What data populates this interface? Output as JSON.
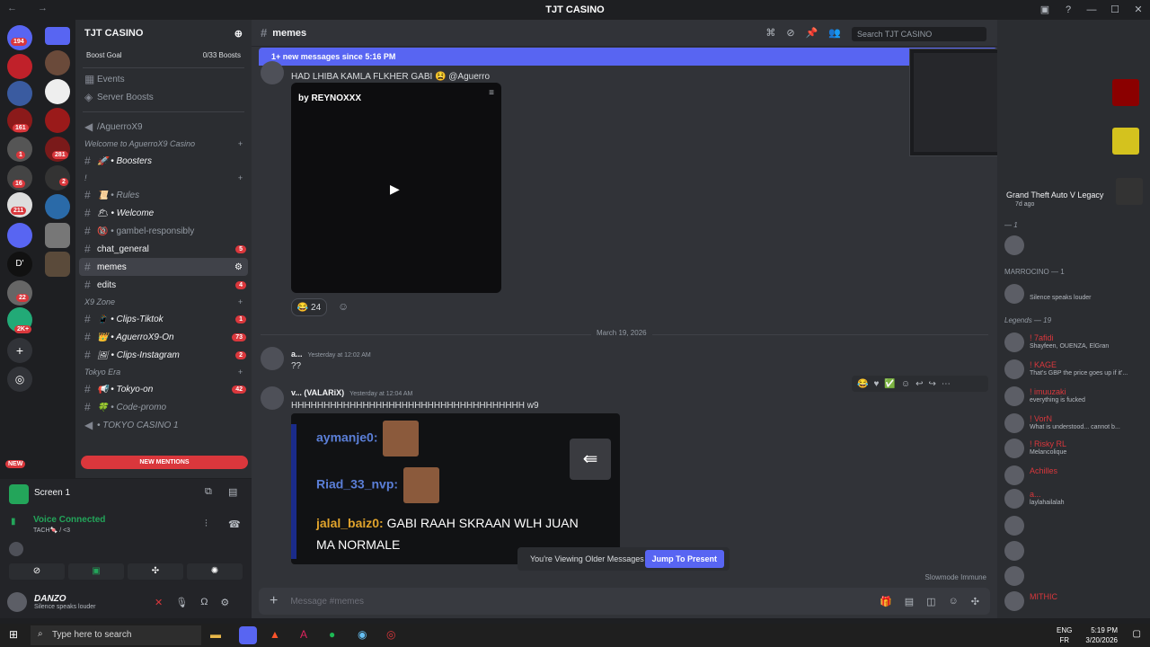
{
  "window": {
    "title": "TJT CASINO",
    "nav": "← →"
  },
  "servers": {
    "badges": [
      "194",
      "161",
      "1",
      "281",
      "2",
      "16",
      "211",
      "22",
      "2K+"
    ],
    "new_label": "NEW"
  },
  "guild": {
    "name": "TJT CASINO",
    "boost_label": "Boost Goal",
    "boost_value": "0/33 Boosts",
    "events": "Events",
    "server_boosts": "Server Boosts",
    "voice_channel": "/AguerroX9",
    "categories": {
      "welcome": "Welcome to AguerroX9 Casino",
      "x9zone": "X9 Zone",
      "tokyo": "Tokyo Era"
    },
    "channels": [
      {
        "label": "🚀 • Boosters",
        "italic": true,
        "bright": true
      },
      {
        "label": "!",
        "italic": false,
        "bright": false
      },
      {
        "label": "📜 • Rules",
        "italic": true,
        "bright": false
      },
      {
        "label": "🌥 • Welcome",
        "italic": true,
        "bright": true
      },
      {
        "label": "🔞 • gambel-responsibly",
        "italic": false,
        "bright": false
      },
      {
        "label": "chat_general",
        "italic": false,
        "bright": true,
        "count": "5"
      },
      {
        "label": "memes",
        "italic": false,
        "bright": true,
        "selected": true
      },
      {
        "label": "edits",
        "italic": false,
        "bright": true,
        "count": "4"
      },
      {
        "label": "📱 • Clips-Tiktok",
        "italic": true,
        "bright": true,
        "count": "1"
      },
      {
        "label": "👑 • AguerroX9-On",
        "italic": true,
        "bright": true,
        "count": "73"
      },
      {
        "label": "🖼 • Clips-Instagram",
        "italic": true,
        "bright": true,
        "count": "2"
      },
      {
        "label": "📢 • Tokyo-on",
        "italic": true,
        "bright": true,
        "count": "42"
      },
      {
        "label": "🍀 • Code-promo",
        "italic": true,
        "bright": false
      },
      {
        "label": "• TOKYO CASINO 1",
        "italic": true,
        "bright": false
      }
    ],
    "new_mentions": "NEW MENTIONS"
  },
  "screen_panel": {
    "title": "Screen 1",
    "voice_connected": "Voice Connected",
    "voice_channel": "TACH🍬 / <3"
  },
  "user": {
    "name": "DANZO",
    "status": "Silence speaks louder"
  },
  "channel_header": {
    "name": "memes",
    "search_placeholder": "Search TJT CASINO"
  },
  "new_messages_banner": "1+ new messages since 5:16 PM",
  "messages": {
    "first_text": "HAD LHIBA KAMLA FLKHER GABI 😫 @Aguerro",
    "video_title": "by REYNOXXX",
    "reaction": "😂 24",
    "date_divider": "March 19, 2026",
    "msg2_user": "a...",
    "msg2_time": "Yesterday at 12:02 AM",
    "msg2_text": "??",
    "msg3_user": "v... (VALARiX)",
    "msg3_time": "Yesterday at 12:04 AM",
    "msg3_text": "HHHHHHHHHHHHHHHHHHHHHHHHHHHHHHHHHHHH w9",
    "embed_lines": {
      "line1_name": "aymanje0:",
      "line2_name": "Riad_33_nvp:",
      "line3_name": "jalal_baiz0:",
      "line3_text": "GABI RAAH SKRAAN WLH JUAN",
      "line4_text": "MA NORMALE"
    }
  },
  "older_messages": {
    "text": "You're Viewing Older Messages",
    "button": "Jump To Present"
  },
  "slowmode": "Slowmode Immune",
  "input_placeholder": "Message #memes",
  "members": {
    "activity_game": "Grand Theft Auto V Legacy",
    "activity_time": "7d ago",
    "section_1": "— 1",
    "marrocino": "MARROCINO — 1",
    "marrocino_status": "Silence speaks louder",
    "legends": "Legends — 19",
    "list": [
      {
        "name": "! 7afidi",
        "status": "Shayfeen, OUENZA, ElGran"
      },
      {
        "name": "! KAGE",
        "status": "That's GBP the price goes up if it'..."
      },
      {
        "name": "! imuuzaki",
        "status": "everything is fucked"
      },
      {
        "name": "! VorN",
        "status": "What is understood... cannot b..."
      },
      {
        "name": "! Risky RL",
        "status": "Melancolique"
      },
      {
        "name": "Achilles",
        "status": ""
      },
      {
        "name": "a...",
        "status": "laylahailalah"
      },
      {
        "name": "",
        "status": ""
      },
      {
        "name": "",
        "status": ""
      },
      {
        "name": "",
        "status": ""
      },
      {
        "name": "MITHIC",
        "status": ""
      }
    ]
  },
  "taskbar": {
    "search": "Type here to search",
    "lang": "ENG",
    "region": "FR",
    "time": "5:19 PM",
    "date": "3/20/2026"
  }
}
